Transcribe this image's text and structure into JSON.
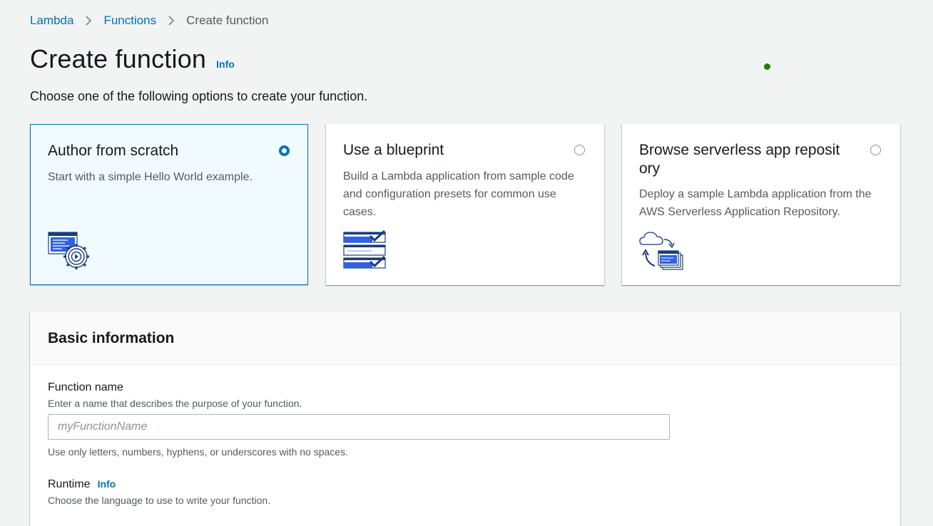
{
  "breadcrumb": {
    "items": [
      "Lambda",
      "Functions",
      "Create function"
    ]
  },
  "header": {
    "title": "Create function",
    "info_label": "Info",
    "subtitle": "Choose one of the following options to create your function."
  },
  "options": [
    {
      "title": "Author from scratch",
      "description": "Start with a simple Hello World example.",
      "selected": true,
      "icon": "code-editor-gear-icon"
    },
    {
      "title": "Use a blueprint",
      "description": "Build a Lambda application from sample code and configuration presets for common use cases.",
      "selected": false,
      "icon": "checklist-icon"
    },
    {
      "title": "Browse serverless app reposit ory",
      "description": "Deploy a sample Lambda application from the AWS Serverless Application Repository.",
      "selected": false,
      "icon": "cloud-deploy-icon"
    }
  ],
  "basic_info": {
    "title": "Basic information",
    "function_name": {
      "label": "Function name",
      "description": "Enter a name that describes the purpose of your function.",
      "placeholder": "myFunctionName",
      "value": "",
      "hint": "Use only letters, numbers, hyphens, or underscores with no spaces."
    },
    "runtime": {
      "label": "Runtime",
      "info_label": "Info",
      "description": "Choose the language to use to write your function."
    }
  },
  "colors": {
    "link": "#0073bb",
    "selected_bg": "#f1faff",
    "status_dot": "#1d8102",
    "page_bg": "#f2f3f3"
  }
}
